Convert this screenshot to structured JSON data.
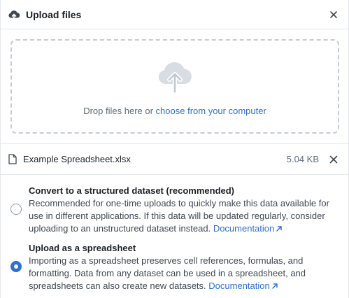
{
  "header": {
    "title": "Upload files",
    "icon": "upload-cloud-icon"
  },
  "dropzone": {
    "text_prefix": "Drop files here or ",
    "link_text": "choose from your computer",
    "icon": "cloud-upload-icon"
  },
  "file": {
    "name": "Example Spreadsheet.xlsx",
    "size": "5.04 KB",
    "icon": "document-icon"
  },
  "options": [
    {
      "title": "Convert to a structured dataset (recommended)",
      "description": "Recommended for one-time uploads to quickly make this data available for use in different applications. If this data will be updated regularly, consider uploading to an unstructured dataset instead.",
      "link_text": "Documentation",
      "selected": false
    },
    {
      "title": "Upload as a spreadsheet",
      "description": "Importing as a spreadsheet preserves cell references, formulas, and formatting. Data from any dataset can be used in a spreadsheet, and spreadsheets can also create new datasets.",
      "link_text": "Documentation",
      "selected": true
    }
  ],
  "colors": {
    "accent": "#2d72d2",
    "text": "#1c2127",
    "muted": "#5f6b7c",
    "border": "#c5cbd3"
  }
}
